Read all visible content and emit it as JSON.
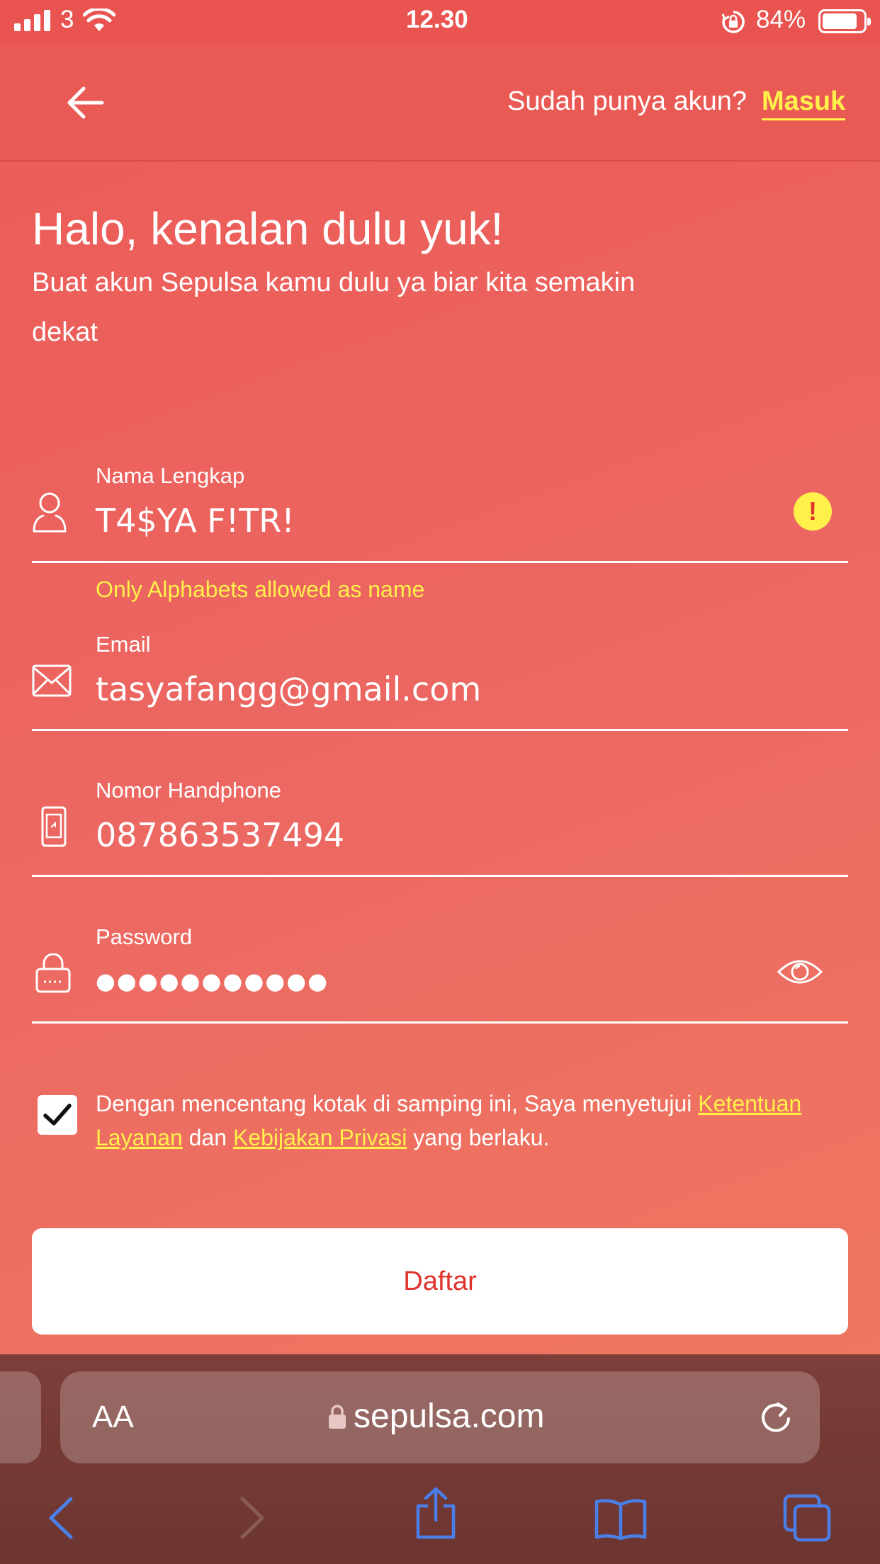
{
  "status_bar": {
    "carrier": "3",
    "time": "12.30",
    "battery_percent": "84%"
  },
  "header": {
    "have_account_text": "Sudah punya akun?",
    "login_link": "Masuk"
  },
  "intro": {
    "title": "Halo, kenalan dulu yuk!",
    "subtitle_line1": "Buat akun Sepulsa kamu dulu ya biar kita semakin",
    "subtitle_line2": "dekat"
  },
  "form": {
    "name": {
      "label": "Nama Lengkap",
      "value": "T4$YA F!TR!",
      "error": "Only Alphabets allowed as name"
    },
    "email": {
      "label": "Email",
      "value": "tasyafangg@gmail.com"
    },
    "phone": {
      "label": "Nomor Handphone",
      "value": "087863537494"
    },
    "password": {
      "label": "Password",
      "value": "●●●●●●●●●●●"
    },
    "terms": {
      "checked": true,
      "text_before": "Dengan mencentang kotak di samping ini, Saya menyetujui ",
      "terms_link": "Ketentuan Layanan",
      "text_middle": " dan ",
      "privacy_link": "Kebijakan Privasi",
      "text_after": " yang berlaku."
    },
    "submit_label": "Daftar"
  },
  "browser": {
    "text_size_label": "AA",
    "url": "sepulsa.com"
  },
  "colors": {
    "background": "#ec5a56",
    "accent_yellow": "#fff04a",
    "button_text": "#e0332c",
    "safari_blue": "#4a7fe8"
  }
}
